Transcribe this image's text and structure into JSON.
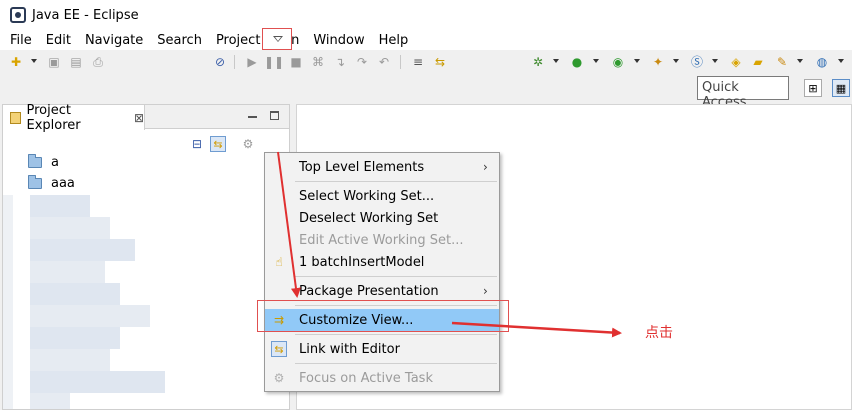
{
  "window": {
    "title": "Java EE - Eclipse"
  },
  "menubar": {
    "items": [
      "File",
      "Edit",
      "Navigate",
      "Search",
      "Project",
      "Run",
      "Window",
      "Help"
    ]
  },
  "quick_access": {
    "placeholder": "Quick Access"
  },
  "project_explorer": {
    "tab_label": "Project Explorer",
    "close_glyph": "⊠",
    "items": [
      {
        "label": "a"
      },
      {
        "label": "aaa"
      }
    ]
  },
  "view_menu": {
    "items": [
      {
        "label": "Top Level Elements",
        "submenu": true,
        "enabled": true,
        "icon": ""
      },
      {
        "label": "Select Working Set...",
        "submenu": false,
        "enabled": true,
        "icon": ""
      },
      {
        "label": "Deselect Working Set",
        "submenu": false,
        "enabled": true,
        "icon": ""
      },
      {
        "label": "Edit Active Working Set...",
        "submenu": false,
        "enabled": false,
        "icon": ""
      },
      {
        "label": "1 batchInsertModel",
        "submenu": false,
        "enabled": true,
        "icon": "working-set-icon"
      },
      {
        "label": "Package Presentation",
        "submenu": true,
        "enabled": true,
        "icon": ""
      },
      {
        "label": "Customize View...",
        "submenu": false,
        "enabled": true,
        "highlighted": true,
        "icon": "customize-view-icon"
      },
      {
        "label": "Link with Editor",
        "submenu": false,
        "enabled": true,
        "icon": "link-with-editor-icon"
      },
      {
        "label": "Focus on Active Task",
        "submenu": false,
        "enabled": false,
        "icon": "focus-task-icon"
      }
    ],
    "submenu_glyph": "›"
  },
  "annotation": {
    "text": "点击",
    "color": "#e03030"
  },
  "colors": {
    "highlight": "#91c9f7",
    "annotation": "#e05050"
  }
}
